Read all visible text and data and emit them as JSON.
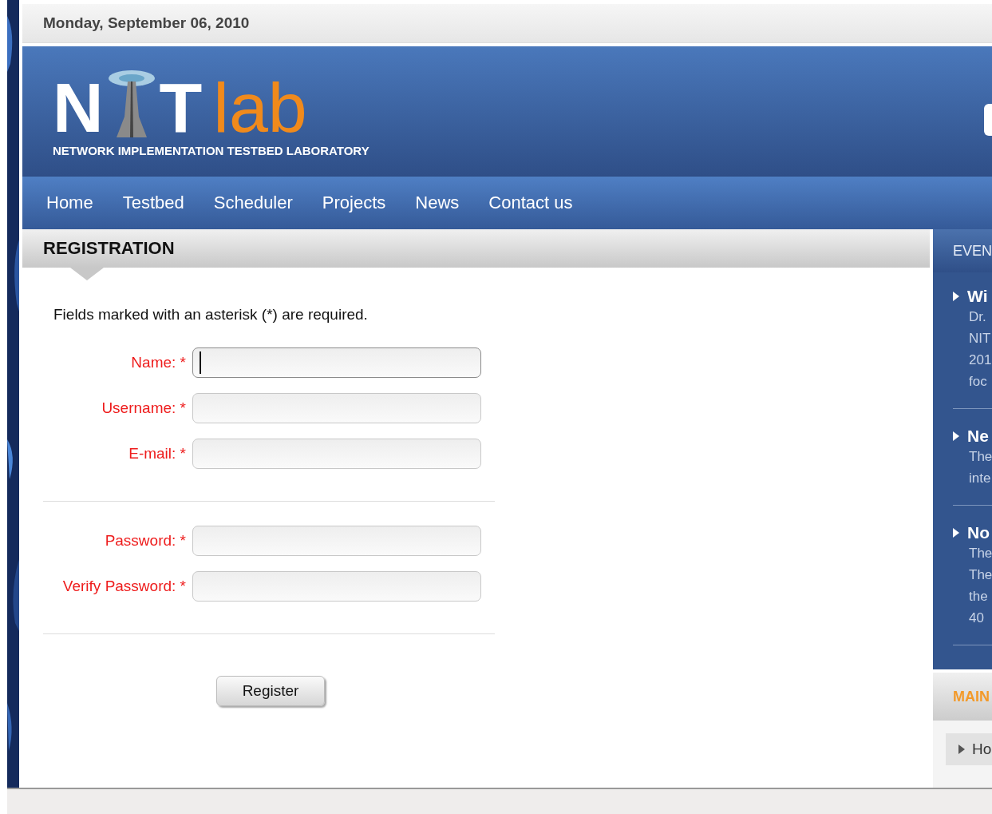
{
  "date": "Monday, September 06, 2010",
  "logo": {
    "first": "N",
    "second": "T",
    "suffix": "lab",
    "tagline": "NETWORK IMPLEMENTATION TESTBED LABORATORY"
  },
  "nav": [
    "Home",
    "Testbed",
    "Scheduler",
    "Projects",
    "News",
    "Contact us"
  ],
  "registration": {
    "title": "REGISTRATION",
    "note": "Fields marked with an asterisk (*) are required.",
    "groups": [
      [
        {
          "label": "Name: *",
          "focused": true
        },
        {
          "label": "Username: *",
          "focused": false
        },
        {
          "label": "E-mail: *",
          "focused": false
        }
      ],
      [
        {
          "label": "Password: *",
          "focused": false
        },
        {
          "label": "Verify Password: *",
          "focused": false
        }
      ]
    ],
    "button": "Register"
  },
  "sidebar": {
    "events_title": "EVEN",
    "events": [
      {
        "title": "Wi",
        "lines": [
          "Dr.",
          "NIT",
          "201",
          "foc"
        ]
      },
      {
        "title": "Ne",
        "lines": [
          "The",
          "inte"
        ]
      },
      {
        "title": "No",
        "lines": [
          "The",
          "The",
          "the",
          "40"
        ]
      }
    ],
    "menu_title": "MAIN",
    "menu": [
      "Ho"
    ]
  }
}
